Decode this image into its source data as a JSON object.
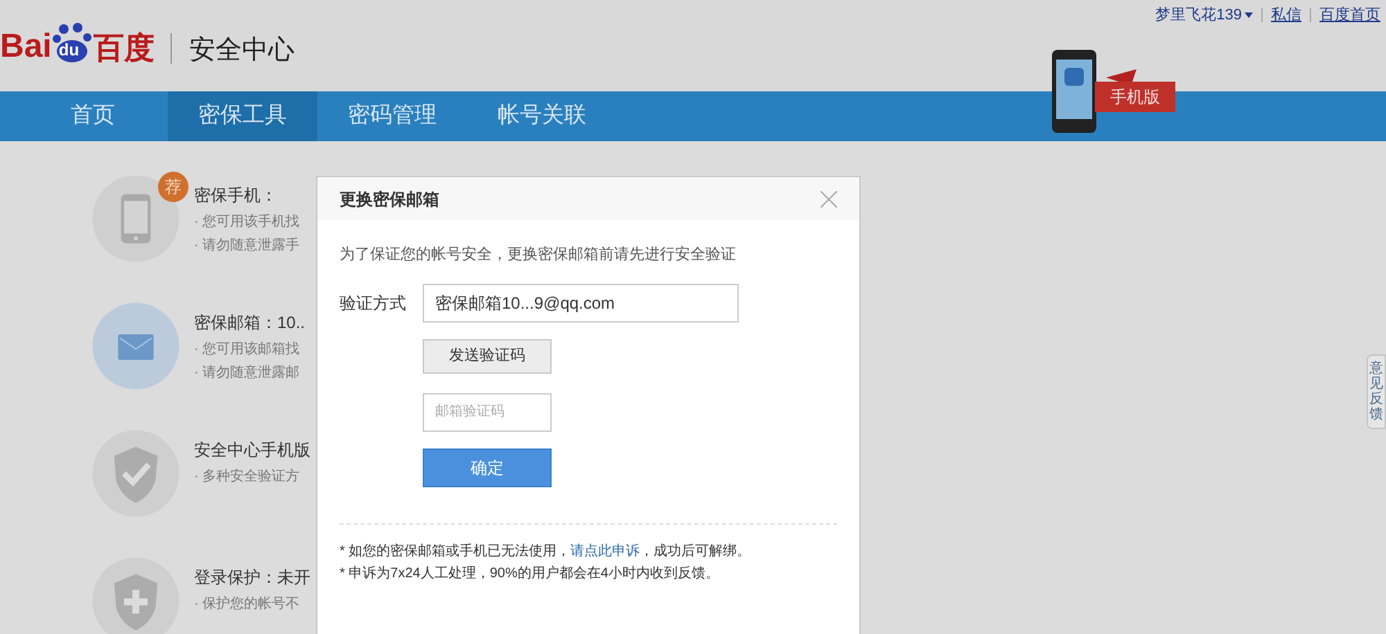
{
  "top_links": {
    "user": "梦里飞花139",
    "messages": "私信",
    "home": "百度首页"
  },
  "header": {
    "logo_latin": "Bai",
    "logo_du": "du",
    "logo_cn": "百度",
    "title": "安全中心",
    "promo": "手机版"
  },
  "nav": [
    {
      "label": "首页",
      "selected": false
    },
    {
      "label": "密保工具",
      "selected": true
    },
    {
      "label": "密码管理",
      "selected": false
    },
    {
      "label": "帐号关联",
      "selected": false
    }
  ],
  "tools": [
    {
      "kind": "phone",
      "title": "密保手机：",
      "badge": "荐",
      "lines": [
        "· 您可用该手机找",
        "· 请勿随意泄露手"
      ]
    },
    {
      "kind": "mail",
      "title": "密保邮箱：10..",
      "lines": [
        "· 您可用该邮箱找",
        "· 请勿随意泄露邮"
      ]
    },
    {
      "kind": "shield",
      "title": "安全中心手机版",
      "lines": [
        "· 多种安全验证方"
      ]
    },
    {
      "kind": "plus",
      "title": "登录保护：未开",
      "lines": [
        "· 保护您的帐号不"
      ]
    }
  ],
  "dialog": {
    "title": "更换密保邮箱",
    "intro": "为了保证您的帐号安全，更换密保邮箱前请先进行安全验证",
    "method_label": "验证方式",
    "method_value": "密保邮箱10...9@qq.com",
    "send_button": "发送验证码",
    "code_placeholder": "邮箱验证码",
    "confirm_button": "确定",
    "note_1_before": "* 如您的密保邮箱或手机已无法使用，",
    "note_1_link": "请点此申诉",
    "note_1_after": "，成功后可解绑。",
    "note_2": "* 申诉为7x24人工处理，90%的用户都会在4小时内收到反馈。"
  },
  "feedback_tab": "意见反馈"
}
